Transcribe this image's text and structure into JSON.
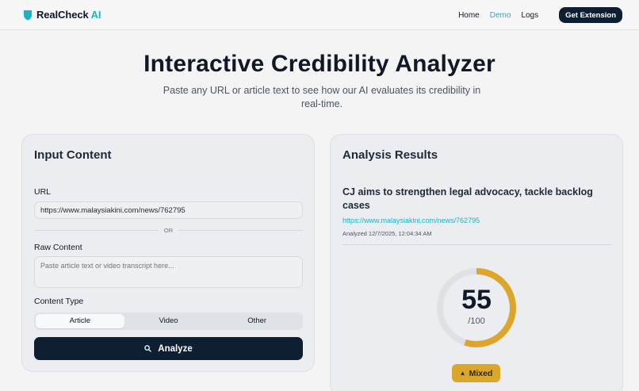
{
  "nav": {
    "brand_part1": "RealCheck",
    "brand_part2": "AI",
    "links": [
      "Home",
      "Demo",
      "Logs"
    ],
    "active_link": "Demo",
    "cta_label": "Get Extension"
  },
  "hero": {
    "title": "Interactive Credibility Analyzer",
    "subtitle": "Paste any URL or article text to see how our AI evaluates its credibility in real-time."
  },
  "input_card": {
    "title": "Input Content",
    "url_label": "URL",
    "url_value": "https://www.malaysiakini.com/news/762795",
    "or_text": "OR",
    "raw_label": "Raw Content",
    "raw_placeholder": "Paste article text or video transcript here...",
    "type_label": "Content Type",
    "type_options": [
      "Article",
      "Video",
      "Other"
    ],
    "type_selected": "Article",
    "analyze_label": "Analyze"
  },
  "results": {
    "title": "Analysis Results",
    "article_title": "CJ aims to strengthen legal advocacy, tackle backlog cases",
    "article_url": "https://www.malaysiakini.com/news/762795",
    "analyzed_at": "Analyzed 12/7/2025, 12:04:34 AM",
    "score": "55",
    "score_max": "/100",
    "score_fraction": 0.55,
    "verdict": "Mixed",
    "verdict_icon": "warning-triangle-icon"
  },
  "colors": {
    "accent": "#1ab3c7",
    "primary_dark": "#0f1f33",
    "gauge_fill": "#dca62a",
    "gauge_track": "#dfe1e5"
  }
}
